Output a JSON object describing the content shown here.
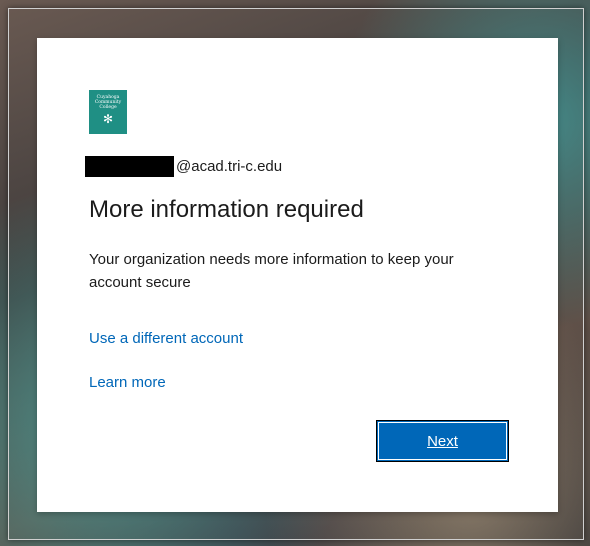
{
  "logo": {
    "text": "Cuyahoga\nCommunity\nCollege",
    "icon": "snowflake-icon",
    "color": "#1f8f84"
  },
  "account": {
    "email_suffix": "@acad.tri-c.edu"
  },
  "title": "More information required",
  "description": "Your organization needs more information to keep your account secure",
  "links": {
    "use_different_account": "Use a different account",
    "learn_more": "Learn more"
  },
  "buttons": {
    "next": "Next"
  },
  "colors": {
    "accent": "#0067b8",
    "text": "#1b1b1b",
    "logo_bg": "#1f8f84"
  }
}
